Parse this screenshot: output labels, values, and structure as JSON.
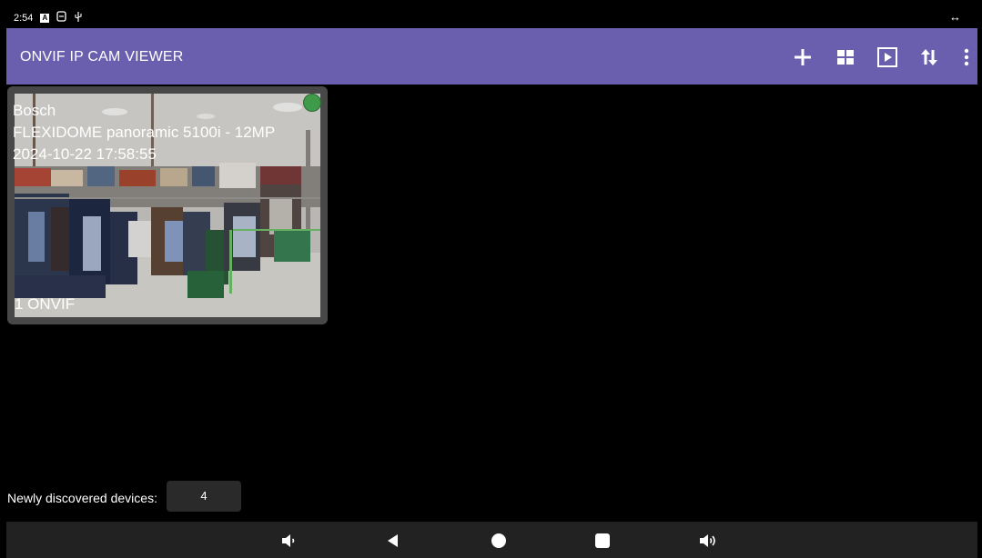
{
  "status_bar": {
    "time": "2:54",
    "notification_icons": [
      "a-icon",
      "sim-icon",
      "usb-icon"
    ],
    "right_icon": "↔"
  },
  "app_bar": {
    "title": "ONVIF IP CAM VIEWER",
    "background_color": "#6a5fae",
    "actions": [
      {
        "name": "add-icon"
      },
      {
        "name": "grid-icon"
      },
      {
        "name": "play-icon"
      },
      {
        "name": "sort-icon"
      },
      {
        "name": "more-vert-icon"
      }
    ]
  },
  "camera": {
    "brand": "Bosch",
    "model": "FLEXIDOME panoramic 5100i - 12MP",
    "timestamp": "2024-10-22 17:58:55",
    "label": "1 ONVIF",
    "status_color": "#3f9a4a"
  },
  "discovered": {
    "label": "Newly discovered devices:",
    "count": "4"
  },
  "nav_bar": {
    "buttons": [
      "volume-down-icon",
      "back-icon",
      "home-icon",
      "recents-icon",
      "volume-up-icon"
    ]
  }
}
